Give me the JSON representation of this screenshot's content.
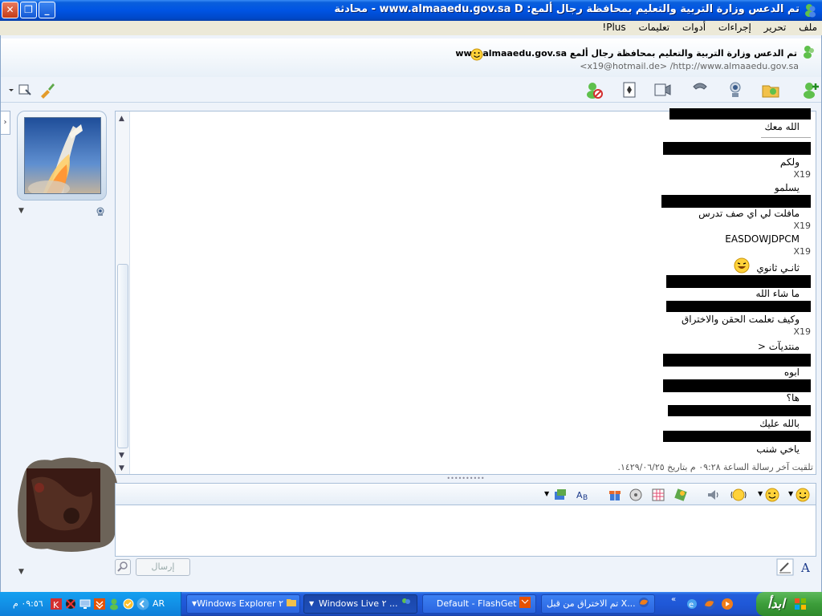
{
  "window": {
    "title": "تم الدعس وزارة التربية والتعليم بمحافظة رجال ألمع: www.almaaedu.gov.sa D - محادثة",
    "close_glyph": "✕",
    "restore_glyph": "❐",
    "min_glyph": "_"
  },
  "menu": [
    "ملف",
    "تحرير",
    "إجراءات",
    "أدوات",
    "تعليمات",
    "Plus!"
  ],
  "contact": {
    "name": "تم الدعس وزارة التربية والتعليم بمحافظة رجال ألمع www.almaaedu.gov.sa",
    "email_line": "<x19@hotmail.de> /http://www.almaaedu.gov.sa"
  },
  "conversation": {
    "messages": [
      {
        "text": "الله معك"
      },
      {
        "text": "ولكم"
      },
      {
        "text": "يسلمو"
      },
      {
        "text": "مافلت لي اي صف تدرس"
      },
      {
        "text": "EASDOWJDPCM"
      },
      {
        "text": "ثانـي ثانوي"
      },
      {
        "text": "ما شاء الله"
      },
      {
        "text": "وكيف تعلمت الحقن والاختراق"
      },
      {
        "text": "منتديآت <"
      },
      {
        "text": "ابوه"
      },
      {
        "text": "ها؟"
      },
      {
        "text": "بالله عليك"
      },
      {
        "text": "ياخي شنب"
      }
    ],
    "sender_tag": "X19",
    "last_message": "تلقيت آخر رسالة الساعة ٠٩:٢٨ م بتاريخ ١٤٢٩/٠٦/٢٥.",
    "splitter": "••••••••••"
  },
  "compose": {
    "send_label": "إرسال"
  },
  "taskbar": {
    "start_label": "ابدأ",
    "tasks": [
      {
        "label": "تم الاختراق من قبل X..."
      },
      {
        "label": "Default - FlashGet"
      },
      {
        "label": "Windows Live ٢ ..."
      },
      {
        "label": "Windows Explorer ٢"
      }
    ],
    "lang": "AR",
    "clock": "٠٩:٥٦ م"
  },
  "colors": {
    "titlebar": "#0054e3",
    "start": "#3c9d3a",
    "taskbar": "#245edb"
  }
}
